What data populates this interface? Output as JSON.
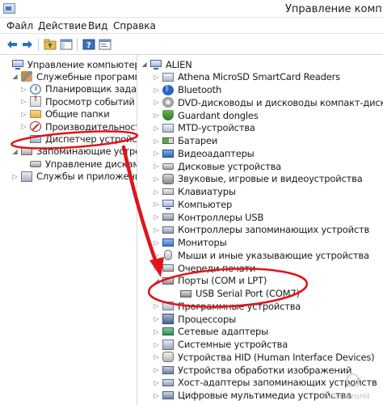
{
  "window": {
    "title": "Управление компью"
  },
  "menu": [
    "Файл",
    "Действие",
    "Вид",
    "Справка"
  ],
  "toolbar": [
    "back-arrow-icon",
    "forward-arrow-icon",
    "up-folder-icon",
    "show-tree-icon",
    "help-icon",
    "properties-icon"
  ],
  "left_tree": [
    {
      "label": "Управление компьютером (л",
      "icon": "computer-management-icon",
      "arrow": "",
      "depth": 0
    },
    {
      "label": "Служебные программы",
      "icon": "tools-icon",
      "arrow": "◢",
      "depth": 1
    },
    {
      "label": "Планировщик заданий",
      "icon": "clock-icon",
      "arrow": "▷",
      "depth": 2
    },
    {
      "label": "Просмотр событий",
      "icon": "event-log-icon",
      "arrow": "▷",
      "depth": 2
    },
    {
      "label": "Общие папки",
      "icon": "shared-folder-icon",
      "arrow": "▷",
      "depth": 2
    },
    {
      "label": "Производительность",
      "icon": "performance-icon",
      "arrow": "▷",
      "depth": 2
    },
    {
      "label": "Диспетчер устройств",
      "icon": "device-manager-icon",
      "arrow": "",
      "depth": 2
    },
    {
      "label": "Запоминающие устройст",
      "icon": "storage-icon",
      "arrow": "◢",
      "depth": 1
    },
    {
      "label": "Управление дисками",
      "icon": "disk-icon",
      "arrow": "",
      "depth": 2
    },
    {
      "label": "Службы и приложения",
      "icon": "services-icon",
      "arrow": "▷",
      "depth": 1
    }
  ],
  "right_tree": {
    "root": "ALIEN",
    "items": [
      {
        "label": "Athena MicroSD SmartCard Readers",
        "icon": "smartcard-icon"
      },
      {
        "label": "Bluetooth",
        "icon": "bluetooth-icon"
      },
      {
        "label": "DVD-дисководы и дисководы компакт-дисков",
        "icon": "dvd-icon"
      },
      {
        "label": "Guardant dongles",
        "icon": "dongle-icon"
      },
      {
        "label": "MTD-устройства",
        "icon": "mtd-icon"
      },
      {
        "label": "Батареи",
        "icon": "battery-icon"
      },
      {
        "label": "Видеоадаптеры",
        "icon": "video-adapter-icon"
      },
      {
        "label": "Дисковые устройства",
        "icon": "disk-drive-icon"
      },
      {
        "label": "Звуковые, игровые и видеоустройства",
        "icon": "sound-icon"
      },
      {
        "label": "Клавиатуры",
        "icon": "keyboard-icon"
      },
      {
        "label": "Компьютер",
        "icon": "computer-icon"
      },
      {
        "label": "Контроллеры USB",
        "icon": "usb-controller-icon"
      },
      {
        "label": "Контроллеры запоминающих устройств",
        "icon": "storage-controller-icon"
      },
      {
        "label": "Мониторы",
        "icon": "monitor-icon"
      },
      {
        "label": "Мыши и иные указывающие устройства",
        "icon": "mouse-icon"
      },
      {
        "label": "Очереди печати",
        "icon": "print-queue-icon"
      },
      {
        "label": "Порты (COM и LPT)",
        "icon": "port-icon",
        "expanded": true
      },
      {
        "label": "USB Serial Port (COM7)",
        "icon": "serial-port-icon",
        "child": true
      },
      {
        "label": "Программные устройства",
        "icon": "software-device-icon"
      },
      {
        "label": "Процессоры",
        "icon": "processor-icon"
      },
      {
        "label": "Сетевые адаптеры",
        "icon": "network-adapter-icon"
      },
      {
        "label": "Системные устройства",
        "icon": "system-device-icon"
      },
      {
        "label": "Устройства HID (Human Interface Devices)",
        "icon": "hid-icon"
      },
      {
        "label": "Устройства обработки изображений",
        "icon": "imaging-icon"
      },
      {
        "label": "Хост-адаптеры запоминающих устройств",
        "icon": "host-adapter-icon"
      },
      {
        "label": "Цифровые мультимедиа устройства",
        "icon": "multimedia-icon"
      }
    ]
  },
  "watermark": "AllScreensHit",
  "colors": {
    "annotation_red": "#e0141b",
    "selection": "#cce4f7"
  }
}
